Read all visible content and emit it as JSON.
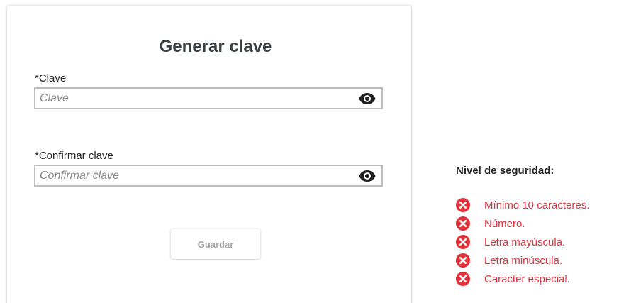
{
  "form": {
    "title": "Generar clave",
    "password": {
      "label": "*Clave",
      "placeholder": "Clave",
      "value": "",
      "toggle_icon": "eye-icon"
    },
    "confirm": {
      "label": "*Confirmar clave",
      "placeholder": "Confirmar clave",
      "value": "",
      "toggle_icon": "eye-icon"
    },
    "save_label": "Guardar",
    "save_enabled": false
  },
  "security": {
    "title": "Nivel de seguridad:",
    "status_icon": "x-circle-icon",
    "status_color": "#e0303a",
    "requirements": [
      {
        "label": "Mínimo 10 caracteres.",
        "met": false
      },
      {
        "label": "Número.",
        "met": false
      },
      {
        "label": "Letra mayúscula.",
        "met": false
      },
      {
        "label": "Letra minúscula.",
        "met": false
      },
      {
        "label": "Caracter especial.",
        "met": false
      }
    ]
  }
}
